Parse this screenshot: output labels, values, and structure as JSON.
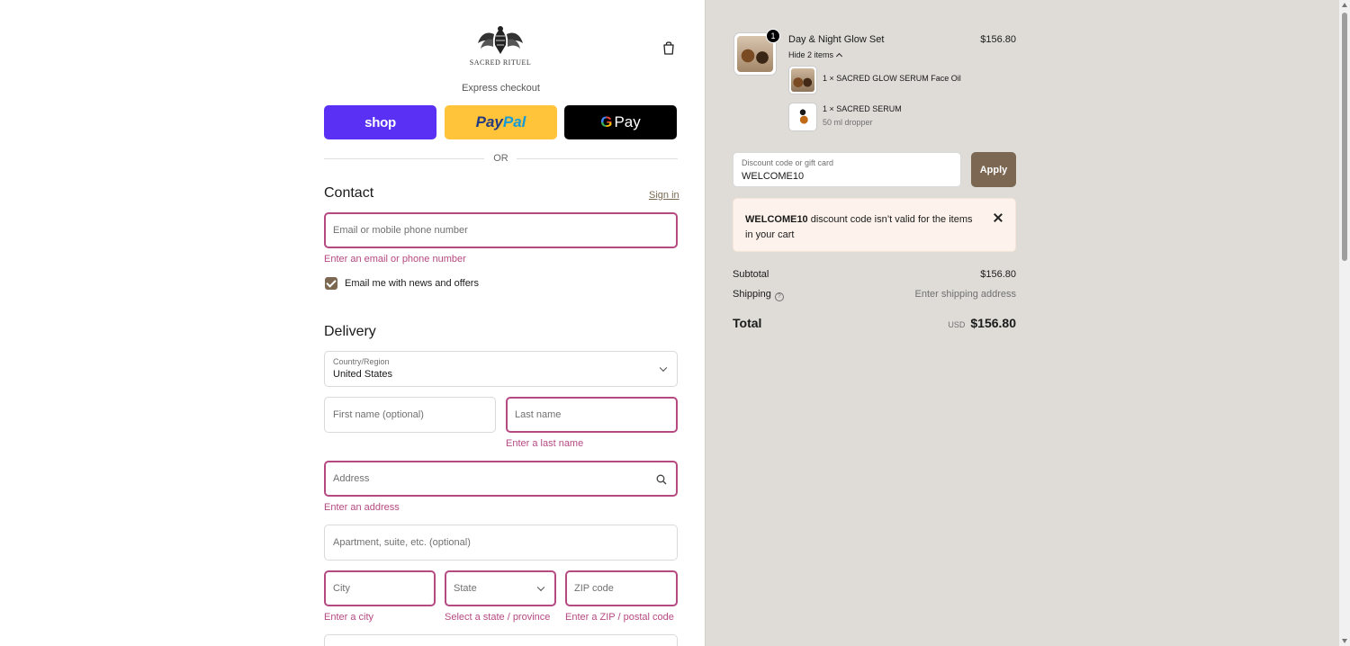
{
  "brand": {
    "name": "SACRED RITUEL"
  },
  "express": {
    "title": "Express checkout",
    "shop_label": "shop",
    "paypal_label_a": "Pay",
    "paypal_label_b": "Pal",
    "gpay_g": "G",
    "gpay_label": "Pay",
    "or_label": "OR"
  },
  "contact": {
    "title": "Contact",
    "signin": "Sign in",
    "email_placeholder": "Email or mobile phone number",
    "email_error": "Enter an email or phone number",
    "newsletter_label": "Email me with news and offers",
    "newsletter_checked": true
  },
  "delivery": {
    "title": "Delivery",
    "country_label": "Country/Region",
    "country_value": "United States",
    "first_name_placeholder": "First name (optional)",
    "last_name_placeholder": "Last name",
    "last_name_error": "Enter a last name",
    "address_placeholder": "Address",
    "address_error": "Enter an address",
    "apartment_placeholder": "Apartment, suite, etc. (optional)",
    "city_placeholder": "City",
    "city_error": "Enter a city",
    "state_placeholder": "State",
    "state_error": "Select a state / province",
    "zip_placeholder": "ZIP code",
    "zip_error": "Enter a ZIP / postal code"
  },
  "order": {
    "item": {
      "name": "Day & Night Glow Set",
      "price": "$156.80",
      "quantity": "1",
      "toggle": "Hide 2 items"
    },
    "sub_items": [
      {
        "name": "1 × SACRED GLOW SERUM Face Oil",
        "variant": ""
      },
      {
        "name": "1 × SACRED SERUM",
        "variant": "50 ml dropper"
      }
    ],
    "discount": {
      "label": "Discount code or gift card",
      "value": "WELCOME10",
      "apply": "Apply"
    },
    "alert": {
      "code": "WELCOME10",
      "message": " discount code isn’t valid for the items in your cart"
    },
    "summary": {
      "subtotal_label": "Subtotal",
      "subtotal_value": "$156.80",
      "shipping_label": "Shipping",
      "shipping_value": "Enter shipping address",
      "total_label": "Total",
      "currency": "USD",
      "total_value": "$156.80"
    }
  },
  "colors": {
    "accent": "#7b6752",
    "error": "#b54a82",
    "shop": "#5a31f4",
    "paypal": "#ffc439",
    "summary_bg": "#dfdcd8"
  }
}
